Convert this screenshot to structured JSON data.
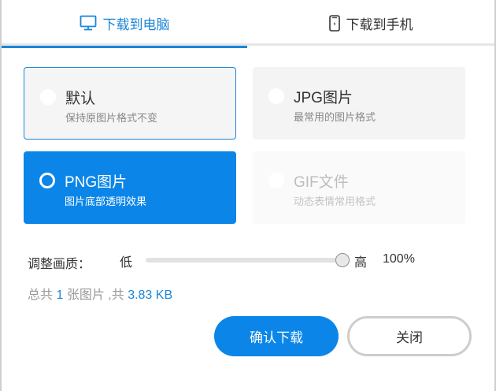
{
  "tabs": {
    "pc_label": "下载到电脑",
    "phone_label": "下载到手机",
    "active": "pc"
  },
  "options": {
    "default": {
      "title": "默认",
      "desc": "保持原图片格式不变",
      "selected": false
    },
    "jpg": {
      "title": "JPG图片",
      "desc": "最常用的图片格式",
      "selected": false
    },
    "png": {
      "title": "PNG图片",
      "desc": "图片底部透明效果",
      "selected": true
    },
    "gif": {
      "title": "GIF文件",
      "desc": "动态表情常用格式",
      "disabled": true
    }
  },
  "quality": {
    "label": "调整画质：",
    "low_label": "低",
    "high_label": "高",
    "value_text": "100%",
    "value": 1.0
  },
  "summary": {
    "prefix": "总共",
    "count": "1",
    "middle": "张图片 ,共",
    "size": "3.83 KB"
  },
  "buttons": {
    "confirm_label": "确认下载",
    "close_label": "关闭"
  },
  "colors": {
    "accent": "#0b86e8",
    "tab_active": "#1a86d8"
  },
  "icons": {
    "pc_tab": "monitor-icon",
    "phone_tab": "phone-icon"
  }
}
